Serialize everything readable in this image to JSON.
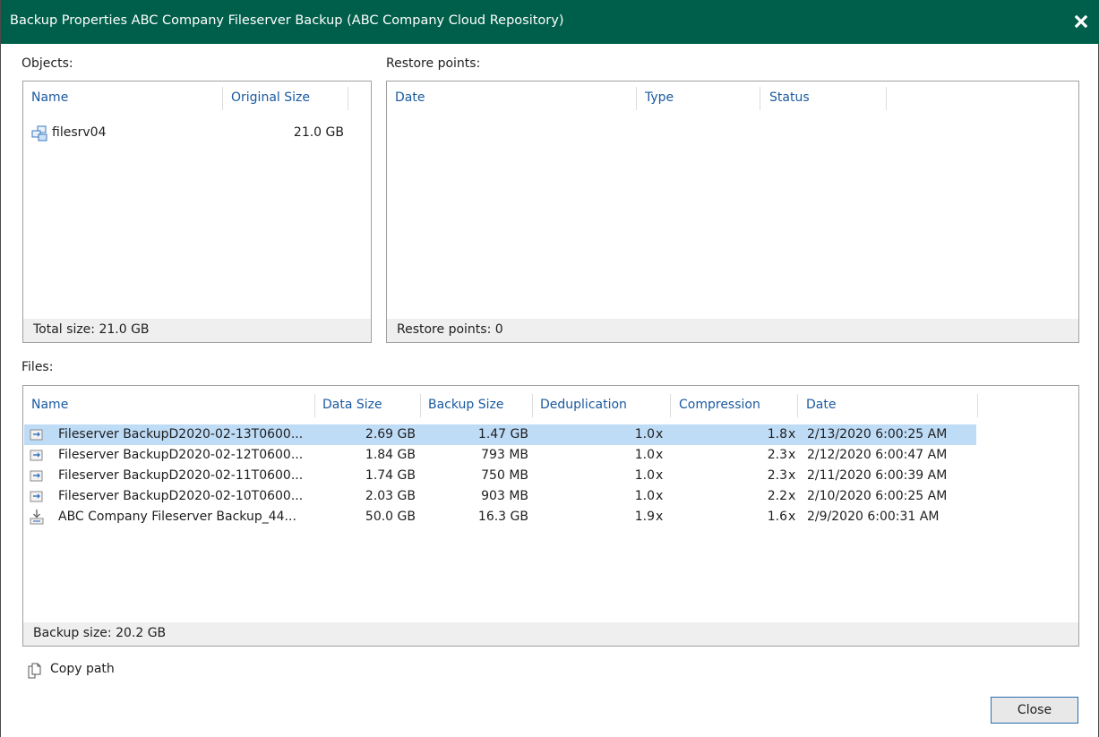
{
  "window": {
    "title": "Backup Properties ABC Company Fileserver Backup (ABC Company Cloud Repository)"
  },
  "objects": {
    "label": "Objects:",
    "columns": [
      "Name",
      "Original Size"
    ],
    "rows": [
      {
        "name": "filesrv04",
        "size": "21.0 GB",
        "icon": "vm-icon"
      }
    ],
    "footer": "Total size: 21.0 GB"
  },
  "restore_points": {
    "label": "Restore points:",
    "columns": [
      "Date",
      "Type",
      "Status"
    ],
    "rows": [],
    "footer": "Restore points: 0"
  },
  "files": {
    "label": "Files:",
    "columns": [
      "Name",
      "Data Size",
      "Backup Size",
      "Deduplication",
      "Compression",
      "Date"
    ],
    "rows": [
      {
        "name": "Fileserver BackupD2020-02-13T0600...",
        "data_size": "2.69 GB",
        "backup_size": "1.47 GB",
        "dedup": "1.0",
        "comp": "1.8",
        "date": "2/13/2020 6:00:25 AM",
        "icon": "incremental-backup-file-icon"
      },
      {
        "name": "Fileserver BackupD2020-02-12T0600...",
        "data_size": "1.84 GB",
        "backup_size": "793 MB",
        "dedup": "1.0",
        "comp": "2.3",
        "date": "2/12/2020 6:00:47 AM",
        "icon": "incremental-backup-file-icon"
      },
      {
        "name": "Fileserver BackupD2020-02-11T0600...",
        "data_size": "1.74 GB",
        "backup_size": "750 MB",
        "dedup": "1.0",
        "comp": "2.3",
        "date": "2/11/2020 6:00:39 AM",
        "icon": "incremental-backup-file-icon"
      },
      {
        "name": "Fileserver BackupD2020-02-10T0600...",
        "data_size": "2.03 GB",
        "backup_size": "903 MB",
        "dedup": "1.0",
        "comp": "2.2",
        "date": "2/10/2020 6:00:25 AM",
        "icon": "incremental-backup-file-icon"
      },
      {
        "name": "ABC Company Fileserver Backup_44...",
        "data_size": "50.0 GB",
        "backup_size": "16.3 GB",
        "dedup": "1.9",
        "comp": "1.6",
        "date": "2/9/2020 6:00:31 AM",
        "icon": "full-backup-file-icon"
      }
    ],
    "ratio_suffix": "x",
    "footer": "Backup size: 20.2 GB"
  },
  "actions": {
    "copy_path": "Copy path",
    "close": "Close"
  },
  "colors": {
    "titlebar": "#005f4b",
    "column_header": "#1a5aa0",
    "selected_row": "#bfdcf7",
    "footer_bg": "#efefef"
  }
}
